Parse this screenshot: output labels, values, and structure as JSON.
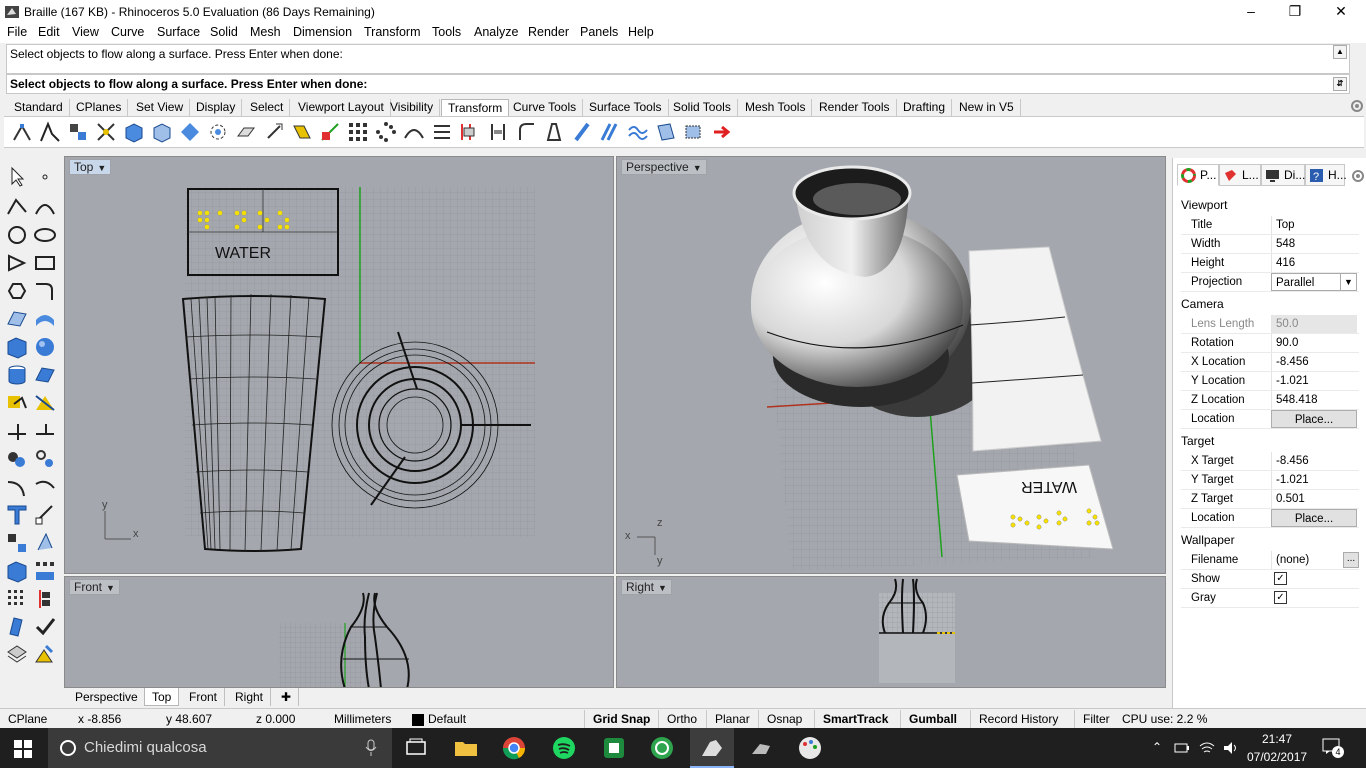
{
  "window": {
    "title": "Braille (167 KB) - Rhinoceros 5.0 Evaluation (86 Days Remaining)",
    "controls": [
      "minimize",
      "restore",
      "close"
    ]
  },
  "menu": [
    "File",
    "Edit",
    "View",
    "Curve",
    "Surface",
    "Solid",
    "Mesh",
    "Dimension",
    "Transform",
    "Tools",
    "Analyze",
    "Render",
    "Panels",
    "Help"
  ],
  "command": {
    "history": "Select objects to flow along a surface. Press Enter when done:",
    "prompt": "Select objects to flow along a surface. Press Enter when done:"
  },
  "toolbar_tabs": [
    "Standard",
    "CPlanes",
    "Set View",
    "Display",
    "Select",
    "Viewport Layout",
    "Visibility",
    "Transform",
    "Curve Tools",
    "Surface Tools",
    "Solid Tools",
    "Mesh Tools",
    "Render Tools",
    "Drafting",
    "New in V5"
  ],
  "active_toolbar_tab": "Transform",
  "viewports": {
    "top": {
      "label": "Top",
      "braille_text": "WATER",
      "axis_x": "x",
      "axis_y": "y"
    },
    "perspective": {
      "label": "Perspective",
      "braille_text": "WATER",
      "axis_x": "x",
      "axis_y": "y",
      "axis_z": "z"
    },
    "front": {
      "label": "Front"
    },
    "right": {
      "label": "Right"
    }
  },
  "viewport_tabs": [
    "Perspective",
    "Top",
    "Front",
    "Right"
  ],
  "active_viewport_tab": "Top",
  "panel": {
    "tabs": [
      "P...",
      "L...",
      "Di...",
      "H..."
    ],
    "sections": {
      "viewport": "Viewport",
      "camera": "Camera",
      "target": "Target",
      "wallpaper": "Wallpaper"
    },
    "viewport_props": [
      {
        "k": "Title",
        "v": "Top"
      },
      {
        "k": "Width",
        "v": "548"
      },
      {
        "k": "Height",
        "v": "416"
      },
      {
        "k": "Projection",
        "v": "Parallel"
      }
    ],
    "camera_props": [
      {
        "k": "Lens Length",
        "v": "50.0"
      },
      {
        "k": "Rotation",
        "v": "90.0"
      },
      {
        "k": "X Location",
        "v": "-8.456"
      },
      {
        "k": "Y Location",
        "v": "-1.021"
      },
      {
        "k": "Z Location",
        "v": "548.418"
      },
      {
        "k": "Location",
        "v": "Place..."
      }
    ],
    "target_props": [
      {
        "k": "X Target",
        "v": "-8.456"
      },
      {
        "k": "Y Target",
        "v": "-1.021"
      },
      {
        "k": "Z Target",
        "v": "0.501"
      },
      {
        "k": "Location",
        "v": "Place..."
      }
    ],
    "wallpaper_props": [
      {
        "k": "Filename",
        "v": "(none)"
      },
      {
        "k": "Show",
        "v": "✓"
      },
      {
        "k": "Gray",
        "v": "✓"
      }
    ],
    "browse": "..."
  },
  "status": {
    "cplane": "CPlane",
    "x": "x -8.856",
    "y": "y 48.607",
    "z": "z 0.000",
    "units": "Millimeters",
    "layer": "Default",
    "toggles": [
      {
        "label": "Grid Snap",
        "on": true
      },
      {
        "label": "Ortho",
        "on": false
      },
      {
        "label": "Planar",
        "on": false
      },
      {
        "label": "Osnap",
        "on": false
      },
      {
        "label": "SmartTrack",
        "on": true
      },
      {
        "label": "Gumball",
        "on": true
      },
      {
        "label": "Record History",
        "on": false
      },
      {
        "label": "Filter",
        "on": false
      }
    ],
    "cpu": "CPU use: 2.2 %"
  },
  "taskbar": {
    "search_placeholder": "Chiedimi qualcosa",
    "time": "21:47",
    "date": "07/02/2017",
    "notifications": "4"
  },
  "colors": {
    "viewport_bg": "#a4a8ae",
    "braille_dots": "#f5e000",
    "x_axis": "#b0321e",
    "y_axis": "#1ea01e"
  }
}
